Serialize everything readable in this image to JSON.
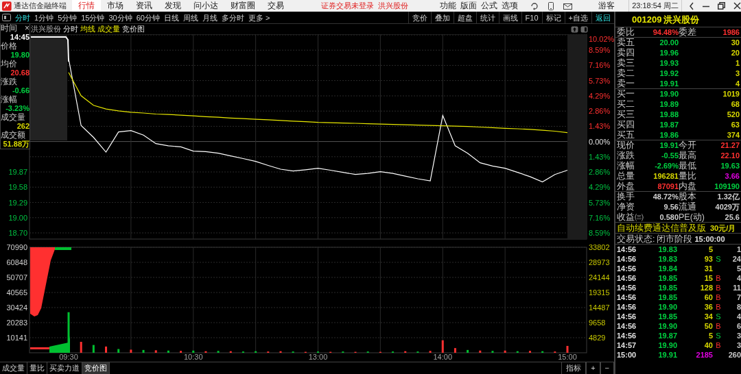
{
  "title_bar": {
    "app": "通达信金融终端",
    "menu": [
      {
        "label": "行情",
        "selected": true
      },
      {
        "label": "市场",
        "selected": false
      },
      {
        "label": "资讯",
        "selected": false
      },
      {
        "label": "发现",
        "selected": false
      },
      {
        "label": "问小达",
        "selected": false
      },
      {
        "label": "财富圈",
        "selected": false
      },
      {
        "label": "交易",
        "selected": false
      }
    ],
    "notice": "证券交易未登录",
    "stock": "洪兴股份",
    "tools": [
      "功能",
      "版面",
      "公式",
      "选项"
    ],
    "user": "游客",
    "clock": "23:18:54 周二"
  },
  "periods": [
    {
      "label": "分时",
      "selected": true
    },
    {
      "label": "1分钟",
      "selected": false
    },
    {
      "label": "5分钟",
      "selected": false
    },
    {
      "label": "15分钟",
      "selected": false
    },
    {
      "label": "30分钟",
      "selected": false
    },
    {
      "label": "60分钟",
      "selected": false
    },
    {
      "label": "日线",
      "selected": false
    },
    {
      "label": "周线",
      "selected": false
    },
    {
      "label": "月线",
      "selected": false
    },
    {
      "label": "多分时",
      "selected": false
    },
    {
      "label": "更多 >",
      "selected": false
    }
  ],
  "toolbar": [
    {
      "label": "竞价",
      "highlighted": false
    },
    {
      "label": "叠加",
      "highlighted": false
    },
    {
      "label": "超盘",
      "highlighted": false
    },
    {
      "label": "统计",
      "highlighted": false
    },
    {
      "label": "画线",
      "highlighted": false
    },
    {
      "label": "F10",
      "highlighted": false
    },
    {
      "label": "标记",
      "highlighted": false
    },
    {
      "label": "+自选",
      "highlighted": false
    },
    {
      "label": "返回",
      "highlighted": true
    }
  ],
  "chart_header": {
    "stock": "洪兴股份",
    "modes": [
      {
        "label": "分时",
        "highlighted": false
      },
      {
        "label": "均线",
        "highlighted": true
      },
      {
        "label": "成交量",
        "highlighted": true
      },
      {
        "label": "竞价图",
        "highlighted": false
      }
    ]
  },
  "info_box": {
    "close": "×",
    "items": [
      {
        "label": "时间",
        "value": "14:45",
        "color": "#ffffff"
      },
      {
        "label": "价格",
        "value": "19.80",
        "color": "#00d040"
      },
      {
        "label": "均价",
        "value": "20.68",
        "color": "#ff3030"
      },
      {
        "label": "涨跌",
        "value": "-0.66",
        "color": "#00d040"
      },
      {
        "label": "涨幅",
        "value": "-3.23%",
        "color": "#00d040"
      },
      {
        "label": "成交量",
        "value": "262",
        "color": "#d8d800"
      },
      {
        "label": "成交额",
        "value": "51.88万",
        "color": "#d8d800"
      }
    ]
  },
  "chart": {
    "chart_data": {
      "type": "line",
      "grid": true,
      "categories": [
        null,
        null,
        null,
        null,
        null,
        null,
        null,
        null,
        null,
        null,
        null,
        null,
        null,
        null,
        null,
        null,
        null,
        null,
        null,
        null,
        null,
        null,
        null,
        null,
        null,
        null,
        null,
        null,
        null,
        null,
        null,
        null,
        null,
        null,
        null,
        null,
        null,
        null,
        null,
        null,
        null
      ],
      "ylim": [
        -8.59,
        10.02
      ],
      "series": [
        {
          "color": "#ffffff",
          "values": [
            7.79,
            1.5,
            0.39,
            -1.0,
            0.9,
            1.03,
            0.6,
            -0.2,
            -0.4,
            -0.5,
            -0.9,
            -0.95,
            -1.1,
            -1.35,
            -1.6,
            -1.87,
            -2.25,
            -2.6,
            -2.77,
            -2.65,
            -2.51,
            -2.7,
            -2.9,
            -3.1,
            -3.0,
            -2.83,
            -3.0,
            -3.25,
            -3.5,
            -3.7,
            2.45,
            -0.4,
            -1.1,
            -2.0,
            -2.3,
            -2.51,
            -2.9,
            -3.3,
            -3.8,
            -3.1,
            -2.7
          ]
        },
        {
          "color": "#e8e800",
          "values": [
            6.5,
            4.3,
            3.4,
            3.05,
            2.88,
            2.75,
            2.68,
            2.58,
            2.54,
            2.48,
            2.41,
            2.34,
            2.28,
            2.21,
            2.15,
            2.09,
            2.04,
            1.98,
            1.92,
            1.86,
            1.8,
            1.77,
            1.74,
            1.71,
            1.67,
            1.64,
            1.61,
            1.58,
            1.54,
            1.51,
            1.48,
            1.45,
            1.42,
            1.36,
            1.3,
            1.24,
            1.2,
            1.14,
            1.06,
            0.97,
            0.84
          ]
        }
      ],
      "yticks": [
        {
          "value": 10.02,
          "label": "10.02%"
        },
        {
          "value": 8.59,
          "label": "8.59%"
        },
        {
          "value": 7.16,
          "label": "7.16%"
        },
        {
          "value": 5.73,
          "label": "5.73%"
        },
        {
          "value": 4.29,
          "label": "4.29%"
        },
        {
          "value": 2.86,
          "label": "2.86%"
        },
        {
          "value": 1.43,
          "label": "1.43%"
        },
        {
          "value": 0,
          "label": "0.00%"
        },
        {
          "value": -1.43,
          "label": "1.43%"
        },
        {
          "value": -2.86,
          "label": "2.86%"
        },
        {
          "value": -4.29,
          "label": "4.29%"
        },
        {
          "value": -5.73,
          "label": "5.73%"
        },
        {
          "value": -7.16,
          "label": "7.16%"
        },
        {
          "value": -8.59,
          "label": "8.59%"
        }
      ]
    },
    "price_axis": [
      "19.87",
      "19.58",
      "19.29",
      "19.00",
      "18.70"
    ]
  },
  "volume": {
    "chart_data": {
      "type": "bar",
      "grid": true,
      "categories": [
        "09:30",
        null,
        null,
        null,
        null,
        null,
        null,
        null,
        null,
        null,
        "10:30",
        null,
        null,
        null,
        null,
        null,
        null,
        null,
        null,
        null,
        "13:00",
        null,
        null,
        null,
        null,
        null,
        null,
        null,
        null,
        null,
        "14:00",
        null,
        null,
        null,
        null,
        null,
        null,
        null,
        null,
        null,
        "15:00"
      ],
      "ylim": [
        0,
        33802
      ],
      "series": [
        {
          "color": "#ff3030",
          "values": [
            null,
            3500,
            null,
            2000,
            null,
            1000,
            null,
            800,
            null,
            600,
            null,
            500,
            null,
            500,
            null,
            null,
            400,
            500,
            null,
            300,
            null,
            300,
            null,
            300,
            null,
            300,
            null,
            500,
            null,
            600,
            4000,
            1500,
            null,
            700,
            null,
            700,
            null,
            600,
            null,
            400,
            2200
          ]
        },
        {
          "color": "#00c030",
          "values": [
            13000,
            null,
            2500,
            null,
            1200,
            null,
            900,
            null,
            700,
            null,
            700,
            null,
            600,
            null,
            400,
            500,
            null,
            null,
            400,
            null,
            400,
            null,
            400,
            null,
            400,
            null,
            400,
            null,
            400,
            null,
            null,
            null,
            900,
            null,
            600,
            null,
            500,
            null,
            500,
            null,
            null
          ]
        }
      ],
      "yticks": [
        {
          "value": 33802,
          "label": "33802"
        },
        {
          "value": 28973,
          "label": "28973"
        },
        {
          "value": 24144,
          "label": "24144"
        },
        {
          "value": 19315,
          "label": "19315"
        },
        {
          "value": 14487,
          "label": "14487"
        },
        {
          "value": 9658,
          "label": "9658"
        },
        {
          "value": 4829,
          "label": "4829"
        }
      ]
    },
    "auction_axis": [
      "70990",
      "60848",
      "50707",
      "40565",
      "30424",
      "20283",
      "10141"
    ]
  },
  "bottom_tabs": [
    {
      "label": "成交量",
      "selected": false
    },
    {
      "label": "量比",
      "selected": false
    },
    {
      "label": "买卖力道",
      "selected": false
    },
    {
      "label": "竞价图",
      "selected": true
    }
  ],
  "bottom_tools": [
    "指标",
    "+",
    "−"
  ],
  "quote": {
    "code": "001209",
    "name": "洪兴股份",
    "order_ratio": [
      {
        "label": "委比",
        "value": "94.48%",
        "color": "#ff3030"
      },
      {
        "label": "委差",
        "value": "1986",
        "color": "#ff3030"
      }
    ],
    "asks": [
      {
        "label": "卖五",
        "price": "20.00",
        "volume": "30"
      },
      {
        "label": "卖四",
        "price": "19.96",
        "volume": "20"
      },
      {
        "label": "卖三",
        "price": "19.93",
        "volume": "1"
      },
      {
        "label": "卖二",
        "price": "19.92",
        "volume": "3"
      },
      {
        "label": "卖一",
        "price": "19.91",
        "volume": "4"
      }
    ],
    "bids": [
      {
        "label": "买一",
        "price": "19.90",
        "volume": "1019"
      },
      {
        "label": "买二",
        "price": "19.89",
        "volume": "68"
      },
      {
        "label": "买三",
        "price": "19.88",
        "volume": "520"
      },
      {
        "label": "买四",
        "price": "19.87",
        "volume": "63"
      },
      {
        "label": "买五",
        "price": "19.86",
        "volume": "374"
      }
    ],
    "stats": [
      [
        {
          "label": "现价",
          "value": "19.91",
          "color": "#00d040"
        },
        {
          "label": "今开",
          "value": "21.27",
          "color": "#ff3030"
        }
      ],
      [
        {
          "label": "涨跌",
          "value": "-0.55",
          "color": "#00d040"
        },
        {
          "label": "最高",
          "value": "22.10",
          "color": "#ff3030"
        }
      ],
      [
        {
          "label": "涨幅",
          "value": "-2.69%",
          "color": "#00d040"
        },
        {
          "label": "最低",
          "value": "19.63",
          "color": "#00d040"
        }
      ],
      [
        {
          "label": "总量",
          "value": "196281",
          "color": "#d8d800"
        },
        {
          "label": "量比",
          "value": "3.66",
          "color": "#e000e0"
        }
      ],
      [
        {
          "label": "外盘",
          "value": "87091",
          "color": "#ff3030"
        },
        {
          "label": "内盘",
          "value": "109190",
          "color": "#00d040"
        }
      ]
    ],
    "finance": [
      [
        {
          "label": "换手",
          "value": "48.72%",
          "color": "#d0d0d0"
        },
        {
          "label": "股本",
          "value": "1.32亿",
          "color": "#d0d0d0"
        }
      ],
      [
        {
          "label": "净资",
          "value": "9.56",
          "color": "#d0d0d0"
        },
        {
          "label": "流通",
          "value": "4029万",
          "color": "#d0d0d0"
        }
      ],
      [
        {
          "label": "收益㈢",
          "value": "0.580",
          "color": "#d0d0d0"
        },
        {
          "label": "PE(动)",
          "value": "25.6",
          "color": "#d0d0d0"
        }
      ]
    ],
    "promo": {
      "text": "自动续费通达信普及版",
      "price": "30元/月"
    },
    "trade_status": {
      "label": "交易状态:",
      "phase": "闭市阶段",
      "time": "15:00:00"
    },
    "trades": [
      {
        "kind": "tick",
        "time": "14:56",
        "price": "19.83",
        "volume": "5",
        "count": "1"
      },
      {
        "kind": "tick",
        "time": "14:56",
        "price": "19.83",
        "volume": "93",
        "side": "S",
        "count": "24"
      },
      {
        "kind": "tick",
        "time": "14:56",
        "price": "19.84",
        "volume": "31",
        "count": "5"
      },
      {
        "kind": "tick",
        "time": "14:56",
        "price": "19.85",
        "volume": "15",
        "side": "B",
        "count": "4"
      },
      {
        "kind": "tick",
        "time": "14:56",
        "price": "19.85",
        "volume": "128",
        "side": "B",
        "count": "11"
      },
      {
        "kind": "tick",
        "time": "14:56",
        "price": "19.85",
        "volume": "60",
        "side": "B",
        "count": "7"
      },
      {
        "kind": "tick",
        "time": "14:56",
        "price": "19.90",
        "volume": "36",
        "side": "B",
        "count": "8"
      },
      {
        "kind": "tick",
        "time": "14:56",
        "price": "19.85",
        "volume": "34",
        "side": "S",
        "count": "4"
      },
      {
        "kind": "tick",
        "time": "14:56",
        "price": "19.90",
        "volume": "50",
        "side": "B",
        "count": "6"
      },
      {
        "kind": "tick",
        "time": "14:56",
        "price": "19.87",
        "volume": "5",
        "side": "S",
        "count": "3"
      },
      {
        "kind": "tick",
        "time": "14:57",
        "price": "19.90",
        "volume": "40",
        "side": "B",
        "count": "3"
      },
      {
        "kind": "close",
        "time": "15:00",
        "price": "19.91",
        "volume": "2185",
        "count": "260"
      }
    ]
  }
}
